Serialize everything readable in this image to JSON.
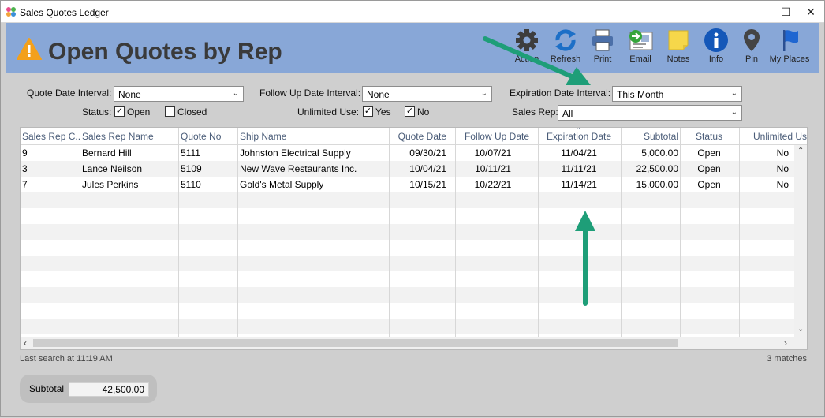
{
  "window": {
    "title": "Sales Quotes Ledger"
  },
  "header": {
    "title": "Open Quotes by Rep"
  },
  "toolbar": [
    {
      "label": "Action",
      "icon": "gear-icon"
    },
    {
      "label": "Refresh",
      "icon": "refresh-icon"
    },
    {
      "label": "Print",
      "icon": "printer-icon"
    },
    {
      "label": "Email",
      "icon": "email-icon"
    },
    {
      "label": "Notes",
      "icon": "sticky-note-icon"
    },
    {
      "label": "Info",
      "icon": "info-icon"
    },
    {
      "label": "Pin",
      "icon": "pin-icon"
    },
    {
      "label": "My Places",
      "icon": "flag-icon"
    }
  ],
  "filters": {
    "quote_date_label": "Quote Date Interval:",
    "quote_date_value": "None",
    "follow_up_label": "Follow Up Date Interval:",
    "follow_up_value": "None",
    "expiration_label": "Expiration Date Interval:",
    "expiration_value": "This Month",
    "status_label": "Status:",
    "open_label": "Open",
    "closed_label": "Closed",
    "unlimited_label": "Unlimited Use:",
    "yes_label": "Yes",
    "no_label": "No",
    "sales_rep_label": "Sales Rep:",
    "sales_rep_value": "All",
    "open_checked": true,
    "closed_checked": false,
    "yes_checked": true,
    "no_checked": true
  },
  "table": {
    "columns": [
      "Sales Rep C...",
      "Sales Rep Name",
      "Quote No",
      "Ship Name",
      "Quote Date",
      "Follow Up Date",
      "Expiration Date",
      "Subtotal",
      "Status",
      "Unlimited Us"
    ],
    "sort_indicator": "^",
    "rows": [
      [
        "9",
        "Bernard Hill",
        "5111",
        "Johnston Electrical Supply",
        "09/30/21",
        "10/07/21",
        "11/04/21",
        "5,000.00",
        "Open",
        "No"
      ],
      [
        "3",
        "Lance Neilson",
        "5109",
        "New Wave Restaurants Inc.",
        "10/04/21",
        "10/11/21",
        "11/11/21",
        "22,500.00",
        "Open",
        "No"
      ],
      [
        "7",
        "Jules Perkins",
        "5110",
        "Gold's Metal Supply",
        "10/15/21",
        "10/22/21",
        "11/14/21",
        "15,000.00",
        "Open",
        "No"
      ]
    ]
  },
  "status": {
    "last_search": "Last search at 11:19 AM",
    "matches": "3 matches"
  },
  "subtotal": {
    "label": "Subtotal",
    "value": "42,500.00"
  },
  "colors": {
    "header_bg": "#88a7d7",
    "annotation_arrow": "#1e9e78"
  }
}
